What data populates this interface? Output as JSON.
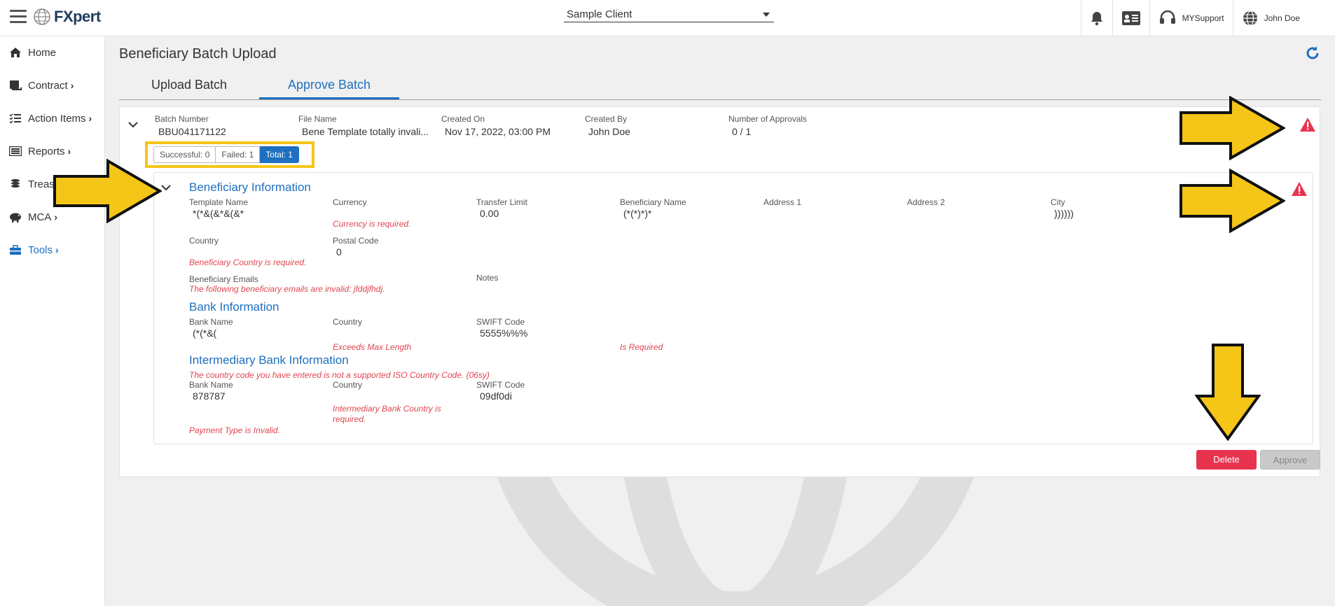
{
  "app": {
    "logo_text": "FXpert"
  },
  "header": {
    "client": "Sample Client",
    "support_label": "MYSupport",
    "user_name": "John Doe"
  },
  "sidebar": {
    "items": [
      {
        "label": "Home",
        "icon": "home-icon"
      },
      {
        "label": "Contract",
        "icon": "contract-icon"
      },
      {
        "label": "Action Items",
        "icon": "checklist-icon"
      },
      {
        "label": "Reports",
        "icon": "reports-icon"
      },
      {
        "label": "Treas",
        "icon": "coins-icon"
      },
      {
        "label": "MCA",
        "icon": "piggy-bank-icon"
      },
      {
        "label": "Tools",
        "icon": "toolbox-icon"
      }
    ]
  },
  "page": {
    "title": "Beneficiary Batch Upload",
    "tabs": [
      {
        "label": "Upload Batch"
      },
      {
        "label": "Approve Batch"
      }
    ]
  },
  "batch": {
    "batch_number_label": "Batch Number",
    "batch_number": "BBU041171122",
    "file_name_label": "File Name",
    "file_name": "Bene Template totally invali...",
    "created_on_label": "Created On",
    "created_on": "Nov 17, 2022, 03:00 PM",
    "created_by_label": "Created By",
    "created_by": "John Doe",
    "approvals_label": "Number of Approvals",
    "approvals": "0 / 1",
    "successful": "Successful: 0",
    "failed": "Failed: 1",
    "total": "Total: 1"
  },
  "beneficiary": {
    "section_title": "Beneficiary Information",
    "template_name_label": "Template Name",
    "template_name": "*(*&(&*&(&*",
    "currency_label": "Currency",
    "currency_error": "Currency is required.",
    "transfer_limit_label": "Transfer Limit",
    "transfer_limit": "0.00",
    "beneficiary_name_label": "Beneficiary Name",
    "beneficiary_name": "(*(*)*)*",
    "address1_label": "Address 1",
    "address2_label": "Address 2",
    "city_label": "City",
    "city": "))))))",
    "country_label": "Country",
    "country_error": "Beneficiary Country is required.",
    "postal_code_label": "Postal Code",
    "postal_code": "0",
    "emails_label": "Beneficiary Emails",
    "emails_error": "The following beneficiary emails are invalid: jfddjfhdj.",
    "notes_label": "Notes"
  },
  "bank": {
    "section_title": "Bank Information",
    "bank_name_label": "Bank Name",
    "bank_name": "(*(*&(",
    "country_label": "Country",
    "country_error": "Exceeds Max Length",
    "swift_label": "SWIFT Code",
    "swift": "5555%%%",
    "swift_error": "Is Required"
  },
  "intermediary": {
    "section_title": "Intermediary Bank Information",
    "country_code_error": "The country code you have entered is not a supported ISO Country Code. (06sy)",
    "bank_name_label": "Bank Name",
    "bank_name": "878787",
    "country_label": "Country",
    "country_error": "Intermediary Bank Country is required.",
    "swift_label": "SWIFT Code",
    "swift": "09df0di",
    "payment_type_error": "Payment Type is Invalid."
  },
  "actions": {
    "delete_label": "Delete",
    "approve_label": "Approve"
  },
  "colors": {
    "accent": "#1e6fc0",
    "error": "#e04550",
    "delete": "#e8334f",
    "annotation": "#f5c518"
  }
}
